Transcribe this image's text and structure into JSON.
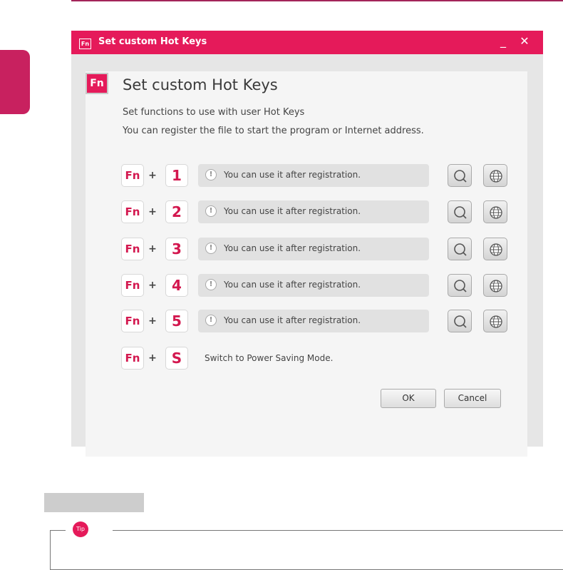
{
  "window": {
    "titlebar_icon": "Fn",
    "title": "Set custom Hot Keys",
    "minimize_glyph": "_",
    "close_glyph": "✕"
  },
  "header": {
    "icon_text": "Fn",
    "title": "Set custom Hot Keys",
    "desc_line1": "Set functions to use with user Hot Keys",
    "desc_line2": "You can register the file to start the program or Internet address."
  },
  "hotkeys": [
    {
      "fn": "Fn",
      "plus": "+",
      "key": "1",
      "status_icon": "!",
      "status": "You can use it after registration."
    },
    {
      "fn": "Fn",
      "plus": "+",
      "key": "2",
      "status_icon": "!",
      "status": "You can use it after registration."
    },
    {
      "fn": "Fn",
      "plus": "+",
      "key": "3",
      "status_icon": "!",
      "status": "You can use it after registration."
    },
    {
      "fn": "Fn",
      "plus": "+",
      "key": "4",
      "status_icon": "!",
      "status": "You can use it after registration."
    },
    {
      "fn": "Fn",
      "plus": "+",
      "key": "5",
      "status_icon": "!",
      "status": "You can use it after registration."
    }
  ],
  "power_saving": {
    "fn": "Fn",
    "plus": "+",
    "key": "S",
    "label": "Switch to Power Saving Mode."
  },
  "buttons": {
    "ok": "OK",
    "cancel": "Cancel"
  },
  "tip": {
    "badge": "Tip"
  },
  "colors": {
    "accent": "#e51a5a",
    "page_accent": "#c8215f",
    "key_text": "#d3184f"
  }
}
